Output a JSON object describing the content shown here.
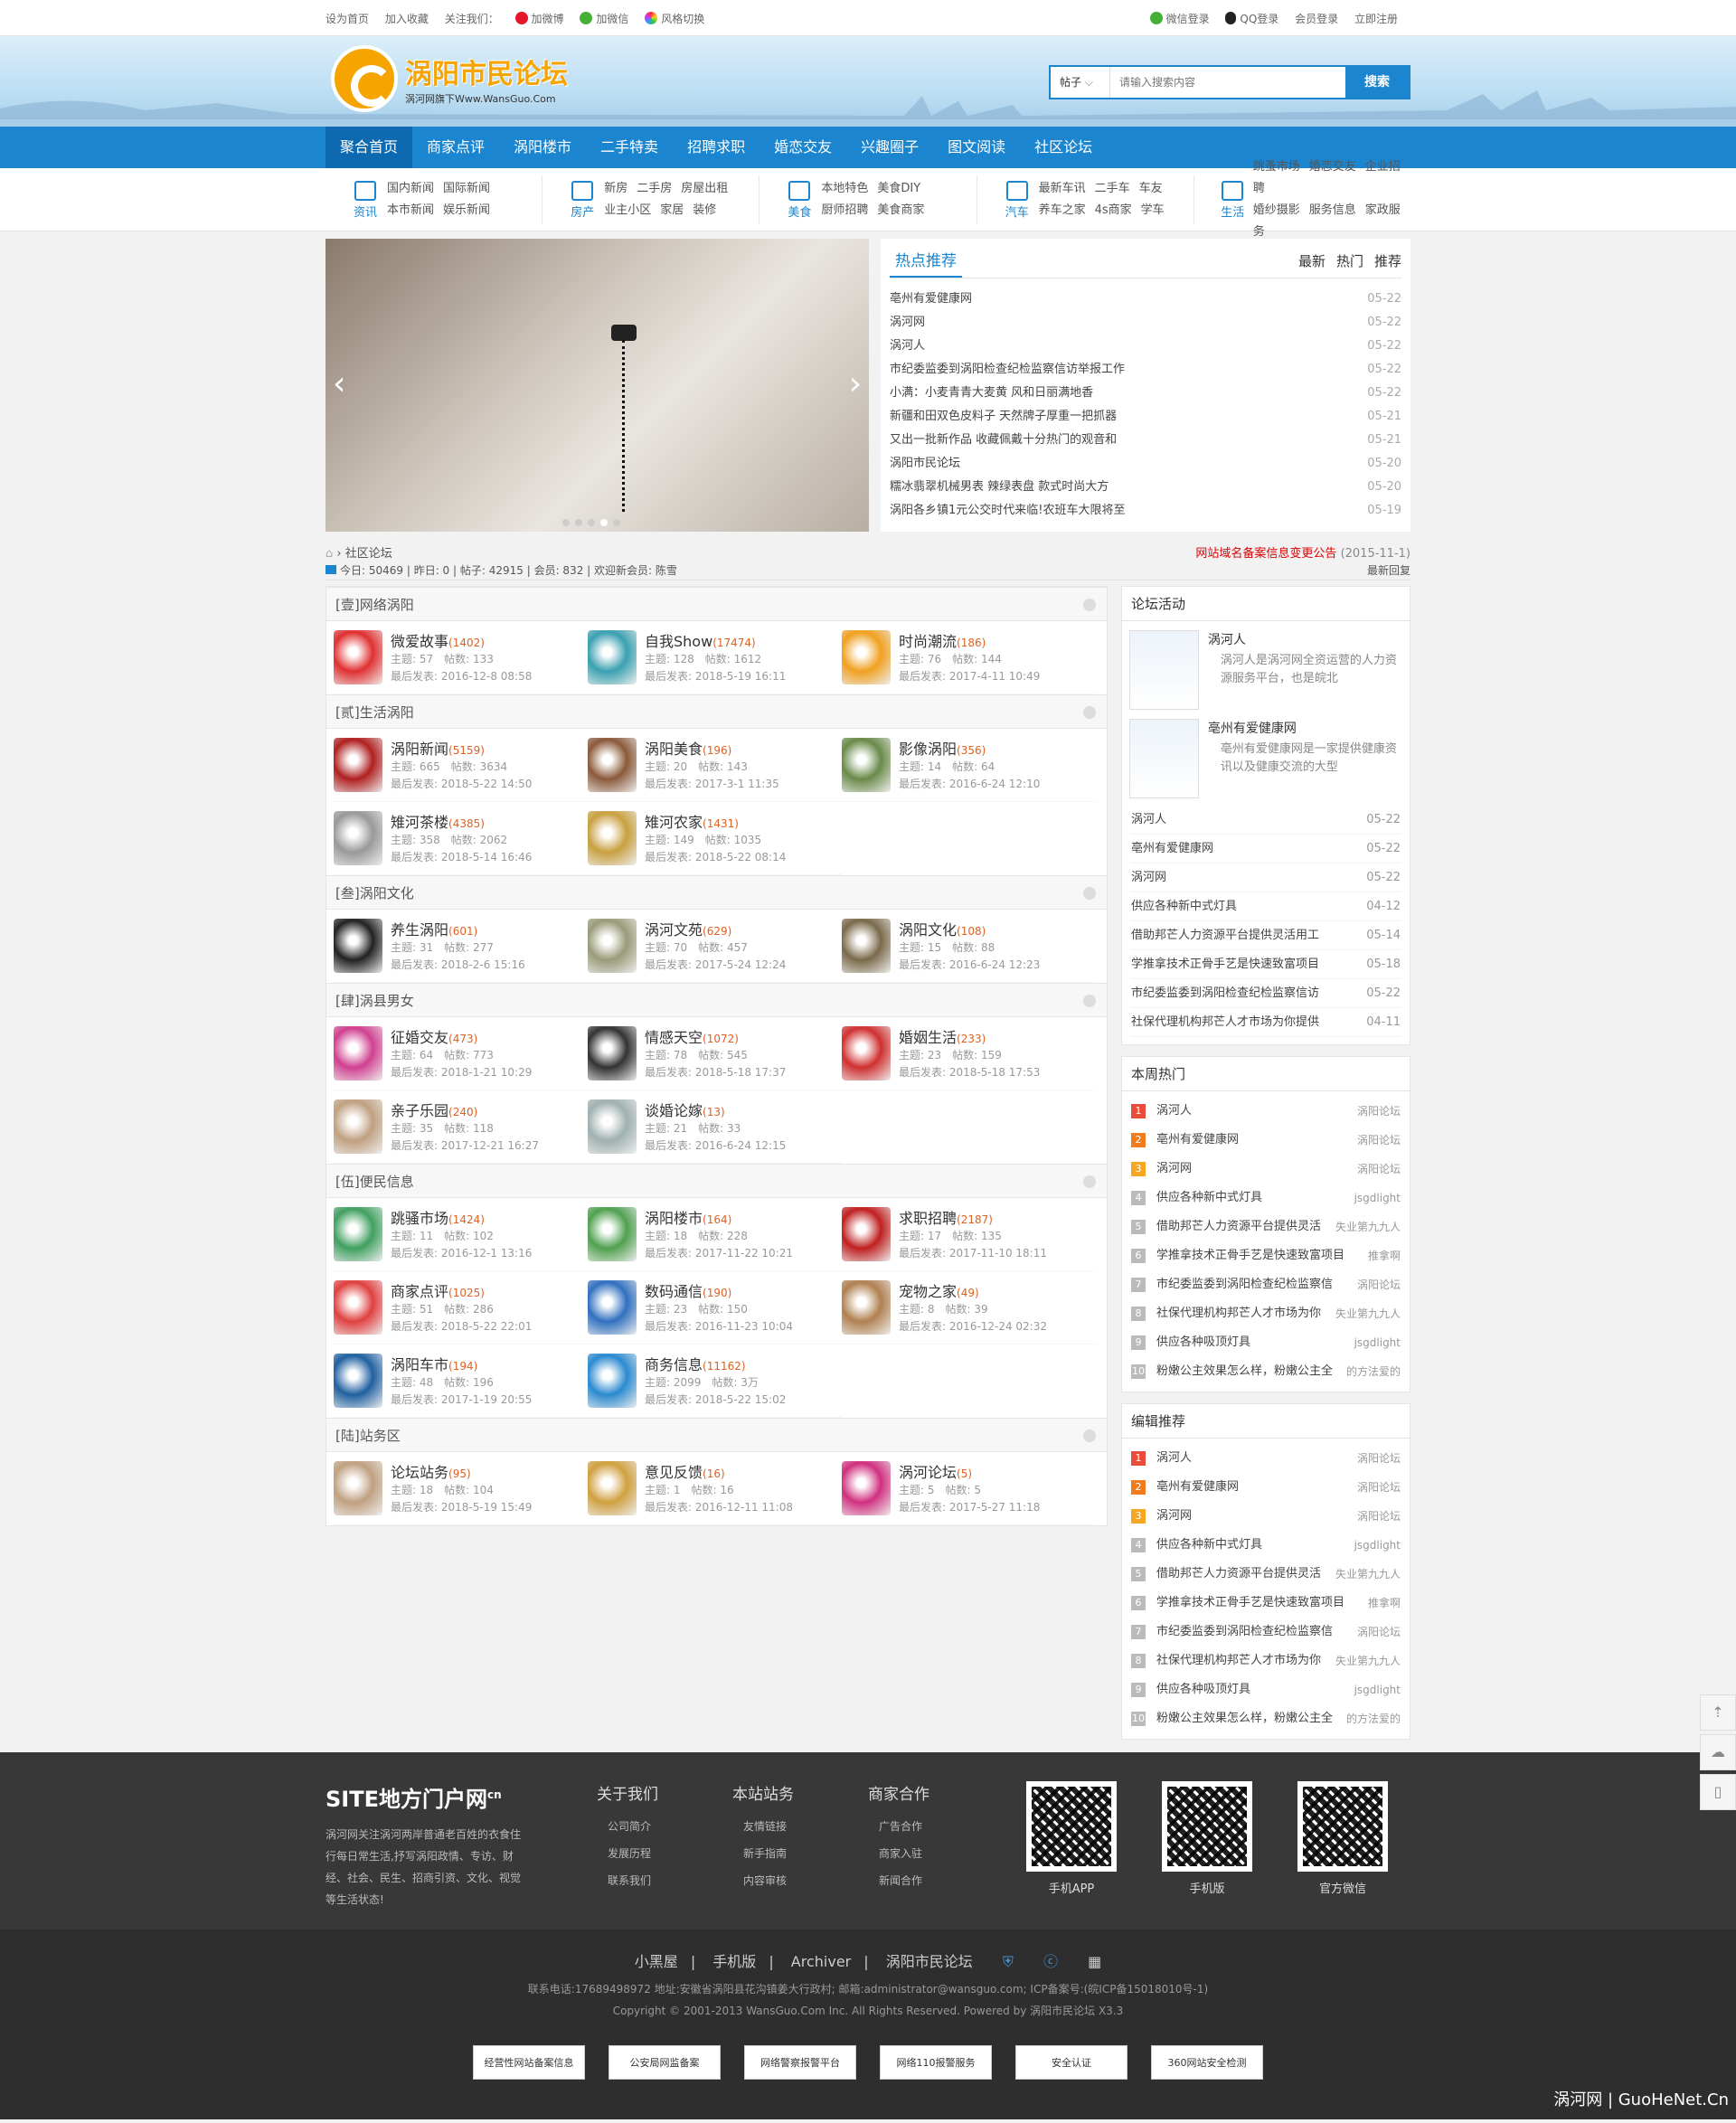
{
  "topbar": {
    "left": [
      "设为首页",
      "加入收藏",
      "关注我们：",
      "加微博",
      "加微信",
      "风格切换"
    ],
    "right": [
      "微信登录",
      "QQ登录",
      "会员登录",
      "立即注册"
    ]
  },
  "header": {
    "logo_title": "涡阳市民论坛",
    "logo_sub": "涡河网旗下Www.WansGuo.Com",
    "search_select": "帖子",
    "search_placeholder": "请输入搜索内容",
    "search_button": "搜索"
  },
  "nav": [
    "聚合首页",
    "商家点评",
    "涡阳楼市",
    "二手特卖",
    "招聘求职",
    "婚恋交友",
    "兴趣圈子",
    "图文阅读",
    "社区论坛"
  ],
  "subnav": [
    {
      "label": "资讯",
      "links": [
        "国内新闻",
        "国际新闻",
        "本市新闻",
        "娱乐新闻"
      ]
    },
    {
      "label": "房产",
      "links": [
        "新房",
        "二手房",
        "房屋出租",
        "业主小区",
        "家居",
        "装修"
      ]
    },
    {
      "label": "美食",
      "links": [
        "本地特色",
        "美食DIY",
        "厨师招聘",
        "美食商家"
      ]
    },
    {
      "label": "汽车",
      "links": [
        "最新车讯",
        "二手车",
        "车友",
        "养车之家",
        "4s商家",
        "学车"
      ]
    },
    {
      "label": "生活",
      "links": [
        "跳蚤市场",
        "婚恋交友",
        "企业招聘",
        "婚纱摄影",
        "服务信息",
        "家政服务"
      ]
    }
  ],
  "hot": {
    "title": "热点推荐",
    "tabs": [
      "最新",
      "热门",
      "推荐"
    ],
    "items": [
      {
        "t": "亳州有爱健康网",
        "d": "05-22"
      },
      {
        "t": "涡河网",
        "d": "05-22"
      },
      {
        "t": "涡河人",
        "d": "05-22"
      },
      {
        "t": "市纪委监委到涡阳检查纪检监察信访举报工作",
        "d": "05-22"
      },
      {
        "t": "小满：小麦青青大麦黄 风和日丽满地香",
        "d": "05-22"
      },
      {
        "t": "新疆和田双色皮料子 天然牌子厚重一把抓器",
        "d": "05-21"
      },
      {
        "t": "又出一批新作品 收藏佩戴十分热门的观音和",
        "d": "05-21"
      },
      {
        "t": "涡阳市民论坛",
        "d": "05-20"
      },
      {
        "t": "糯冰翡翠机械男表 辣绿表盘 款式时尚大方",
        "d": "05-20"
      },
      {
        "t": "涡阳各乡镇1元公交时代来临!农班车大限将至",
        "d": "05-19"
      }
    ]
  },
  "crumb": {
    "path": "社区论坛",
    "notice": "网站域名备案信息变更公告",
    "notice_date": "(2015-11-1)"
  },
  "stats": {
    "text": "今日: 50469 | 昨日: 0 | 帖子: 42915 | 会员: 832 | 欢迎新会员: 陈雪",
    "right": "最新回复"
  },
  "categories": [
    {
      "name": "[壹]网络涡阳",
      "forums": [
        {
          "n": "微爱故事",
          "c": "(1402)",
          "s1": "主题: 57　帖数: 133",
          "s2": "最后发表: 2016-12-8 08:58",
          "col": "#e03030"
        },
        {
          "n": "自我Show",
          "c": "(17474)",
          "s1": "主题: 128　帖数: 1612",
          "s2": "最后发表: 2018-5-19 16:11",
          "col": "#3aa0b0"
        },
        {
          "n": "时尚潮流",
          "c": "(186)",
          "s1": "主题: 76　帖数: 144",
          "s2": "最后发表: 2017-4-11 10:49",
          "col": "#f0a020"
        }
      ]
    },
    {
      "name": "[贰]生活涡阳",
      "forums": [
        {
          "n": "涡阳新闻",
          "c": "(5159)",
          "s1": "主题: 665　帖数: 3634",
          "s2": "最后发表: 2018-5-22 14:50",
          "col": "#b02020"
        },
        {
          "n": "涡阳美食",
          "c": "(196)",
          "s1": "主题: 20　帖数: 143",
          "s2": "最后发表: 2017-3-1 11:35",
          "col": "#8a5a3a"
        },
        {
          "n": "影像涡阳",
          "c": "(356)",
          "s1": "主题: 14　帖数: 64",
          "s2": "最后发表: 2016-6-24 12:10",
          "col": "#6a8a4a"
        },
        {
          "n": "雉河茶楼",
          "c": "(4385)",
          "s1": "主题: 358　帖数: 2062",
          "s2": "最后发表: 2018-5-14 16:46",
          "col": "#999999"
        },
        {
          "n": "雉河农家",
          "c": "(1431)",
          "s1": "主题: 149　帖数: 1035",
          "s2": "最后发表: 2018-5-22 08:14",
          "col": "#c8a040"
        }
      ]
    },
    {
      "name": "[叁]涡阳文化",
      "forums": [
        {
          "n": "养生涡阳",
          "c": "(601)",
          "s1": "主题: 31　帖数: 277",
          "s2": "最后发表: 2018-2-6 15:16",
          "col": "#222222"
        },
        {
          "n": "涡河文苑",
          "c": "(629)",
          "s1": "主题: 70　帖数: 457",
          "s2": "最后发表: 2017-5-24 12:24",
          "col": "#9a9a7a"
        },
        {
          "n": "涡阳文化",
          "c": "(108)",
          "s1": "主题: 15　帖数: 88",
          "s2": "最后发表: 2016-6-24 12:23",
          "col": "#7a6a4a"
        }
      ]
    },
    {
      "name": "[肆]涡县男女",
      "forums": [
        {
          "n": "征婚交友",
          "c": "(473)",
          "s1": "主题: 64　帖数: 773",
          "s2": "最后发表: 2018-1-21 10:29",
          "col": "#d04090"
        },
        {
          "n": "情感天空",
          "c": "(1072)",
          "s1": "主题: 78　帖数: 545",
          "s2": "最后发表: 2018-5-18 17:37",
          "col": "#333333"
        },
        {
          "n": "婚姻生活",
          "c": "(233)",
          "s1": "主题: 23　帖数: 159",
          "s2": "最后发表: 2018-5-18 17:53",
          "col": "#d03030"
        },
        {
          "n": "亲子乐园",
          "c": "(240)",
          "s1": "主题: 35　帖数: 118",
          "s2": "最后发表: 2017-12-21 16:27",
          "col": "#c0a080"
        },
        {
          "n": "谈婚论嫁",
          "c": "(13)",
          "s1": "主题: 21　帖数: 33",
          "s2": "最后发表: 2016-6-24 12:15",
          "col": "#a0b0b0"
        }
      ]
    },
    {
      "name": "[伍]便民信息",
      "forums": [
        {
          "n": "跳骚市场",
          "c": "(1424)",
          "s1": "主题: 11　帖数: 102",
          "s2": "最后发表: 2016-12-1 13:16",
          "col": "#40a060"
        },
        {
          "n": "涡阳楼市",
          "c": "(164)",
          "s1": "主题: 18　帖数: 228",
          "s2": "最后发表: 2017-11-22 10:21",
          "col": "#50a050"
        },
        {
          "n": "求职招聘",
          "c": "(2187)",
          "s1": "主题: 17　帖数: 135",
          "s2": "最后发表: 2017-11-10 18:11",
          "col": "#c02020"
        },
        {
          "n": "商家点评",
          "c": "(1025)",
          "s1": "主题: 51　帖数: 286",
          "s2": "最后发表: 2018-5-22 22:01",
          "col": "#e04040"
        },
        {
          "n": "数码通信",
          "c": "(190)",
          "s1": "主题: 23　帖数: 150",
          "s2": "最后发表: 2016-11-23 10:04",
          "col": "#3070c0"
        },
        {
          "n": "宠物之家",
          "c": "(49)",
          "s1": "主题: 8　帖数: 39",
          "s2": "最后发表: 2016-12-24 02:32",
          "col": "#b08050"
        },
        {
          "n": "涡阳车市",
          "c": "(194)",
          "s1": "主题: 48　帖数: 196",
          "s2": "最后发表: 2017-1-19 20:55",
          "col": "#2060a0"
        },
        {
          "n": "商务信息",
          "c": "(11162)",
          "s1": "主题: 2099　帖数: 3万",
          "s2": "最后发表: 2018-5-22 15:02",
          "col": "#2a8ad0"
        }
      ]
    },
    {
      "name": "[陆]站务区",
      "forums": [
        {
          "n": "论坛站务",
          "c": "(95)",
          "s1": "主题: 18　帖数: 104",
          "s2": "最后发表: 2018-5-19 15:49",
          "col": "#c0a080"
        },
        {
          "n": "意见反馈",
          "c": "(16)",
          "s1": "主题: 1　帖数: 16",
          "s2": "最后发表: 2016-12-11 11:08",
          "col": "#d0a040"
        },
        {
          "n": "涡河论坛",
          "c": "(5)",
          "s1": "主题: 5　帖数: 5",
          "s2": "最后发表: 2017-5-27 11:18",
          "col": "#d03080"
        }
      ]
    }
  ],
  "side": {
    "activity_title": "论坛活动",
    "activities": [
      {
        "t": "涡河人",
        "d": "涡河人是涡河网全资运营的人力资源服务平台，也是皖北"
      },
      {
        "t": "亳州有爱健康网",
        "d": "亳州有爱健康网是一家提供健康资讯以及健康交流的大型"
      }
    ],
    "list": [
      {
        "t": "涡河人",
        "d": "05-22"
      },
      {
        "t": "亳州有爱健康网",
        "d": "05-22"
      },
      {
        "t": "涡河网",
        "d": "05-22"
      },
      {
        "t": "供应各种新中式灯具",
        "d": "04-12"
      },
      {
        "t": "借助邦芒人力资源平台提供灵活用工",
        "d": "05-14"
      },
      {
        "t": "学推拿技术正骨手艺是快速致富项目",
        "d": "05-18"
      },
      {
        "t": "市纪委监委到涡阳检查纪检监察信访",
        "d": "05-22"
      },
      {
        "t": "社保代理机构邦芒人才市场为你提供",
        "d": "04-11"
      }
    ],
    "weekly_title": "本周热门",
    "editor_title": "编辑推荐",
    "rank": [
      {
        "no": "1",
        "t": "涡河人",
        "a": "涡阳论坛"
      },
      {
        "no": "2",
        "t": "亳州有爱健康网",
        "a": "涡阳论坛"
      },
      {
        "no": "3",
        "t": "涡河网",
        "a": "涡阳论坛"
      },
      {
        "no": "4",
        "t": "供应各种新中式灯具",
        "a": "jsgdlight"
      },
      {
        "no": "5",
        "t": "借助邦芒人力资源平台提供灵活",
        "a": "失业第九九人"
      },
      {
        "no": "6",
        "t": "学推拿技术正骨手艺是快速致富项目",
        "a": "推拿啊"
      },
      {
        "no": "7",
        "t": "市纪委监委到涡阳检查纪检监察信",
        "a": "涡阳论坛"
      },
      {
        "no": "8",
        "t": "社保代理机构邦芒人才市场为你",
        "a": "失业第九九人"
      },
      {
        "no": "9",
        "t": "供应各种吸顶灯具",
        "a": "jsgdlight"
      },
      {
        "no": "10",
        "t": "粉嫩公主效果怎么样，粉嫩公主全",
        "a": "的方法爱的"
      }
    ],
    "rank_colors": [
      "#e84c3d",
      "#f07c1e",
      "#f5a623"
    ]
  },
  "footer": {
    "brand": "SITE地方门户网",
    "brand_sup": "cn",
    "desc": "涡河网关注涡河两岸普通老百姓的衣食住行每日常生活,抒写涡阳政情、专访、财经、社会、民生、招商引资、文化、视觉等生活状态!",
    "cols": [
      {
        "h": "关于我们",
        "items": [
          "公司简介",
          "发展历程",
          "联系我们"
        ]
      },
      {
        "h": "本站站务",
        "items": [
          "友情链接",
          "新手指南",
          "内容审核"
        ]
      },
      {
        "h": "商家合作",
        "items": [
          "广告合作",
          "商家入驻",
          "新闻合作"
        ]
      }
    ],
    "qrs": [
      "手机APP",
      "手机版",
      "官方微信"
    ]
  },
  "bottom": {
    "links": [
      "小黑屋",
      "手机版",
      "Archiver",
      "涡阳市民论坛"
    ],
    "contact": "联系电话:17689498972 地址:安徽省涡阳县花沟镇姜大行政村; 邮箱:administrator@wansguo.com; ICP备案号:(皖ICP备15018010号-1)",
    "copyright": "Copyright © 2001-2013 WansGuo.Com Inc. All Rights Reserved.  Powered by 涡阳市民论坛 X3.3",
    "badges": [
      "经营性网站备案信息",
      "公安局网监备案",
      "网络警察报警平台",
      "网络110报警服务",
      "安全认证",
      "360网站安全检测"
    ],
    "watermark": "涡河网 | GuoHeNet.Cn"
  }
}
